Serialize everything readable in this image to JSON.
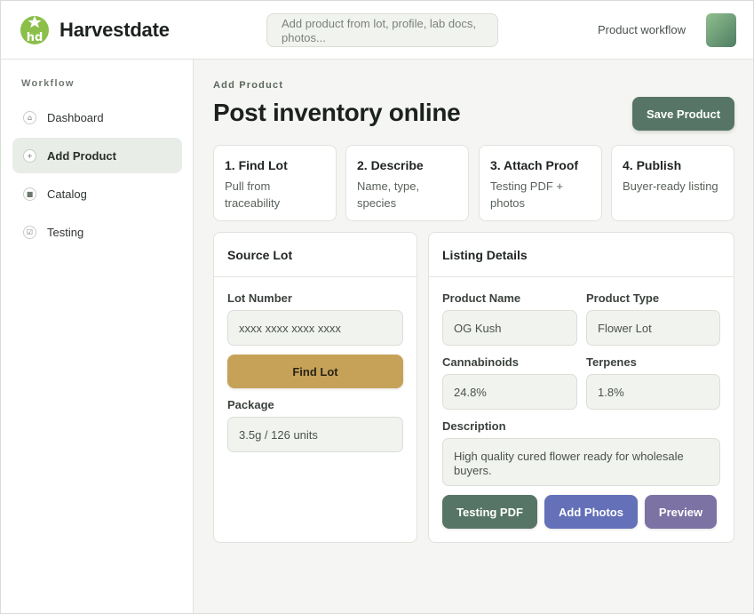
{
  "header": {
    "brand": "Harvestdate",
    "logo_icon": "hd-star-logo-icon",
    "search_placeholder": "Add product from lot, profile, lab docs, photos...",
    "workflow_label": "Product workflow",
    "avatar_colors": [
      "#8fbf8c",
      "#4f7d62"
    ]
  },
  "sidebar": {
    "heading": "Workflow",
    "items": [
      {
        "label": "Dashboard",
        "icon": "home-icon",
        "glyph": "⌂",
        "active": false
      },
      {
        "label": "Add Product",
        "icon": "plus-icon",
        "glyph": "+",
        "active": true
      },
      {
        "label": "Catalog",
        "icon": "square-icon",
        "glyph": "■",
        "active": false
      },
      {
        "label": "Testing",
        "icon": "checkbox-icon",
        "glyph": "☑",
        "active": false
      }
    ]
  },
  "main": {
    "eyebrow": "Add Product",
    "title": "Post inventory online",
    "save_label": "Save Product",
    "steps": [
      {
        "title": "1. Find Lot",
        "desc": "Pull from traceability"
      },
      {
        "title": "2. Describe",
        "desc": "Name, type, species"
      },
      {
        "title": "3. Attach Proof",
        "desc": "Testing PDF + photos"
      },
      {
        "title": "4. Publish",
        "desc": "Buyer-ready listing"
      }
    ],
    "source_lot": {
      "title": "Source Lot",
      "lot_label": "Lot Number",
      "lot_placeholder": "xxxx xxxx xxxx xxxx",
      "find_label": "Find Lot",
      "package_label": "Package",
      "package_value": "3.5g / 126 units"
    },
    "listing": {
      "title": "Listing Details",
      "name_label": "Product Name",
      "name_value": "OG Kush",
      "type_label": "Product Type",
      "type_value": "Flower Lot",
      "cannabinoids_label": "Cannabinoids",
      "cannabinoids_value": "24.8%",
      "terpenes_label": "Terpenes",
      "terpenes_value": "1.8%",
      "description_label": "Description",
      "description_value": "High quality cured flower ready for wholesale buyers.",
      "testing_label": "Testing PDF",
      "photos_label": "Add Photos",
      "preview_label": "Preview"
    }
  },
  "colors": {
    "accent": "#577566",
    "find_lot": "#c6a258",
    "testing_pdf": "#577566",
    "add_photos": "#6470b8",
    "preview": "#7c72a3",
    "active_nav": "#e8ede7"
  }
}
